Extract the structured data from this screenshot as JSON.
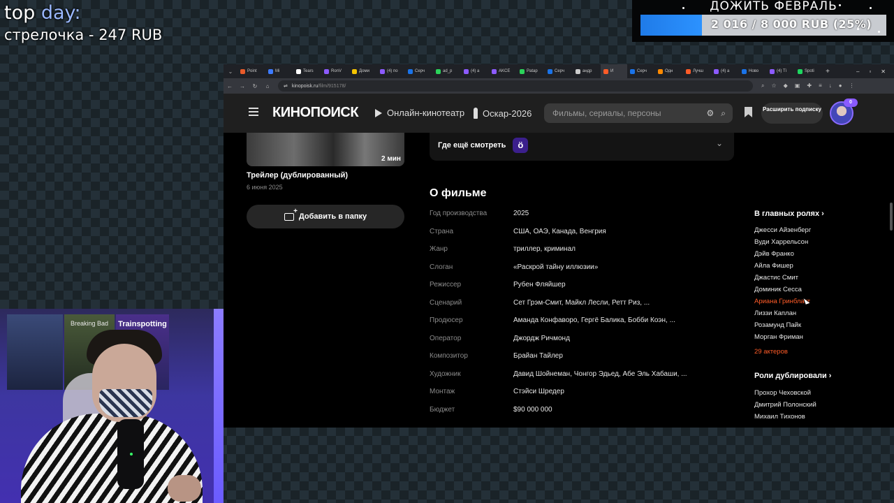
{
  "overlay": {
    "topday_title_a": "top",
    "topday_title_b": "day:",
    "topday_line": "стрелочка - 247 RUB",
    "goal_title": "ДОЖИТЬ ФЕВРАЛЬ",
    "goal_text": "2 016 / 8 000 RUB (25%)",
    "goal_progress": 0.25,
    "accent_color": "#2c92ff"
  },
  "webcam": {
    "poster_1": "",
    "poster_2": "Breaking Bad",
    "poster_3": "Trainspotting"
  },
  "browser": {
    "tabs": [
      {
        "label": "Point",
        "color": "#e85b2a"
      },
      {
        "label": "Mi",
        "color": "#3d7bff"
      },
      {
        "label": "Tears",
        "color": "#ffffff"
      },
      {
        "label": "RonV",
        "color": "#8c5bff"
      },
      {
        "label": "Доми",
        "color": "#f5c400"
      },
      {
        "label": "(4) по",
        "color": "#8c5bff"
      },
      {
        "label": "Серч",
        "color": "#1a73e8"
      },
      {
        "label": "ad_p",
        "color": "#2bd35a"
      },
      {
        "label": "(4) а",
        "color": "#8c5bff"
      },
      {
        "label": "AKCE",
        "color": "#8c5bff"
      },
      {
        "label": "Patap",
        "color": "#2bd35a"
      },
      {
        "label": "Серч",
        "color": "#1a73e8"
      },
      {
        "label": "андр",
        "color": "#cccccc"
      },
      {
        "label": "И",
        "color": "#ff5c28",
        "active": true
      },
      {
        "label": "Серч",
        "color": "#1a73e8"
      },
      {
        "label": "Одн",
        "color": "#ff8a00"
      },
      {
        "label": "Лучш",
        "color": "#ff5c28"
      },
      {
        "label": "(4) а",
        "color": "#8c5bff"
      },
      {
        "label": "Ново",
        "color": "#1a73e8"
      },
      {
        "label": "(4) Ті",
        "color": "#8c5bff"
      },
      {
        "label": "Spoti",
        "color": "#1ed760"
      }
    ],
    "url_host": "kinopoisk.ru",
    "url_path": "/film/915178/"
  },
  "kinopoisk": {
    "logo": "КИНОПОИСК",
    "nav_online": "Онлайн-кинотеатр",
    "nav_oscar": "Оскар-2026",
    "search_placeholder": "Фильмы, сериалы, персоны",
    "subscribe_btn": "Расширить подписку",
    "avatar_badge": "0",
    "trailer": {
      "duration": "2 мин",
      "title": "Трейлер (дублированный)",
      "date": "6 июня 2025"
    },
    "add_folder": "Добавить в папку",
    "where_to_watch": "Где ещё смотреть",
    "okko_glyph": "ö",
    "about_title": "О фильме",
    "facts": [
      {
        "key": "Год производства",
        "value": "2025"
      },
      {
        "key": "Страна",
        "value": "США, ОАЭ, Канада, Венгрия"
      },
      {
        "key": "Жанр",
        "value": "триллер, криминал"
      },
      {
        "key": "Слоган",
        "value": "«Раскрой тайну иллюзии»"
      },
      {
        "key": "Режиссер",
        "value": "Рубен Фляйшер"
      },
      {
        "key": "Сценарий",
        "value": "Сет Грэм-Смит, Майкл Лесли, Ретт Риз, ..."
      },
      {
        "key": "Продюсер",
        "value": "Аманда Конфаворо, Гергё Балика, Бобби Коэн, ..."
      },
      {
        "key": "Оператор",
        "value": "Джордж Ричмонд"
      },
      {
        "key": "Композитор",
        "value": "Брайан Тайлер"
      },
      {
        "key": "Художник",
        "value": "Давид Шойнеман, Чонгор Эдьед, Абе Эль Хабаши, ..."
      },
      {
        "key": "Монтаж",
        "value": "Стэйси Шредер"
      },
      {
        "key": "Бюджет",
        "value": "$90 000 000"
      }
    ],
    "cast_heading": "В главных ролях",
    "cast": [
      "Джесси Айзенберг",
      "Вуди Харрельсон",
      "Дэйв Франко",
      "Айла Фишер",
      "Джастис Смит",
      "Доминик Сесса",
      "Ариана Гринблатт",
      "Лиззи Каплан",
      "Розамунд Пайк",
      "Морган Фриман"
    ],
    "cast_more": "29 актеров",
    "dub_heading": "Роли дублировали",
    "dub_cast": [
      "Прохор Чеховской",
      "Дмитрий Полонский",
      "Михаил Тихонов"
    ]
  }
}
